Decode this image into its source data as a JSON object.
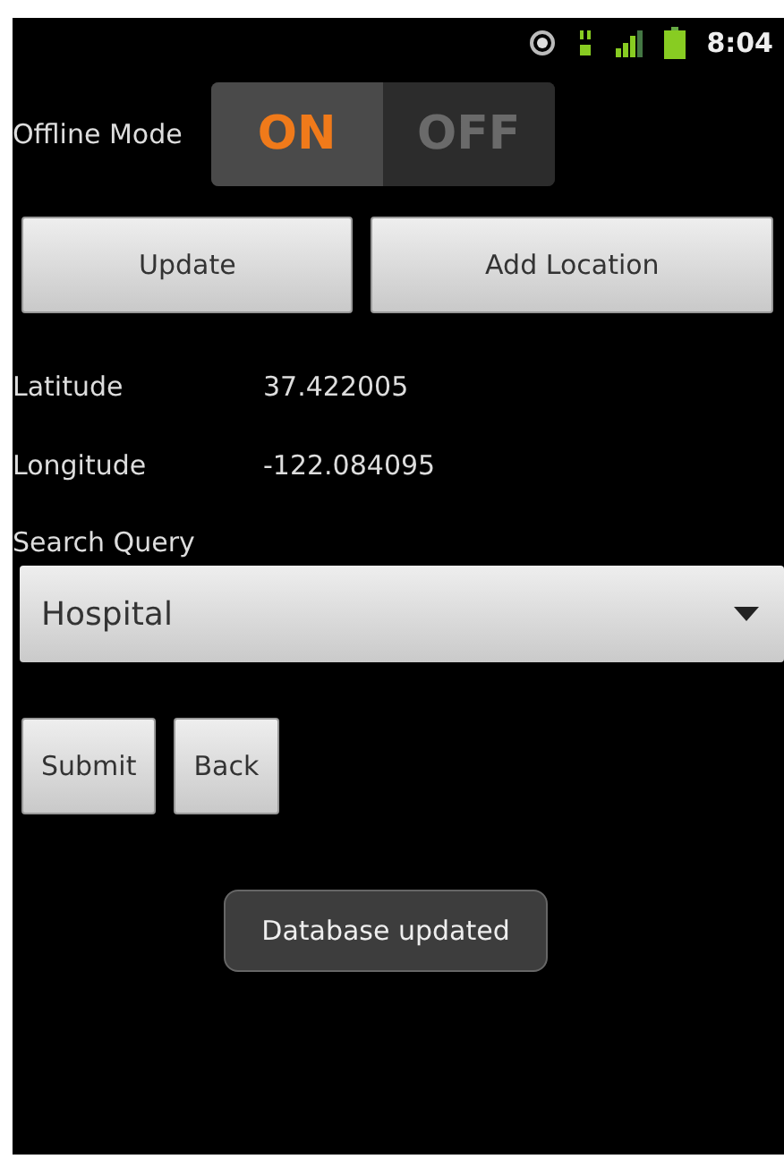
{
  "status_bar": {
    "time": "8:04"
  },
  "offline": {
    "label": "Offline Mode",
    "on_label": "ON",
    "off_label": "OFF",
    "on": true
  },
  "actions": [
    "Update",
    "Add Location"
  ],
  "coords": [
    {
      "label": "Latitude",
      "value": "37.422005"
    },
    {
      "label": "Longitude",
      "value": "-122.084095"
    }
  ],
  "search": {
    "label": "Search Query",
    "value": "Hospital"
  },
  "buttons": [
    "Submit",
    "Back"
  ],
  "toast": "Database updated"
}
